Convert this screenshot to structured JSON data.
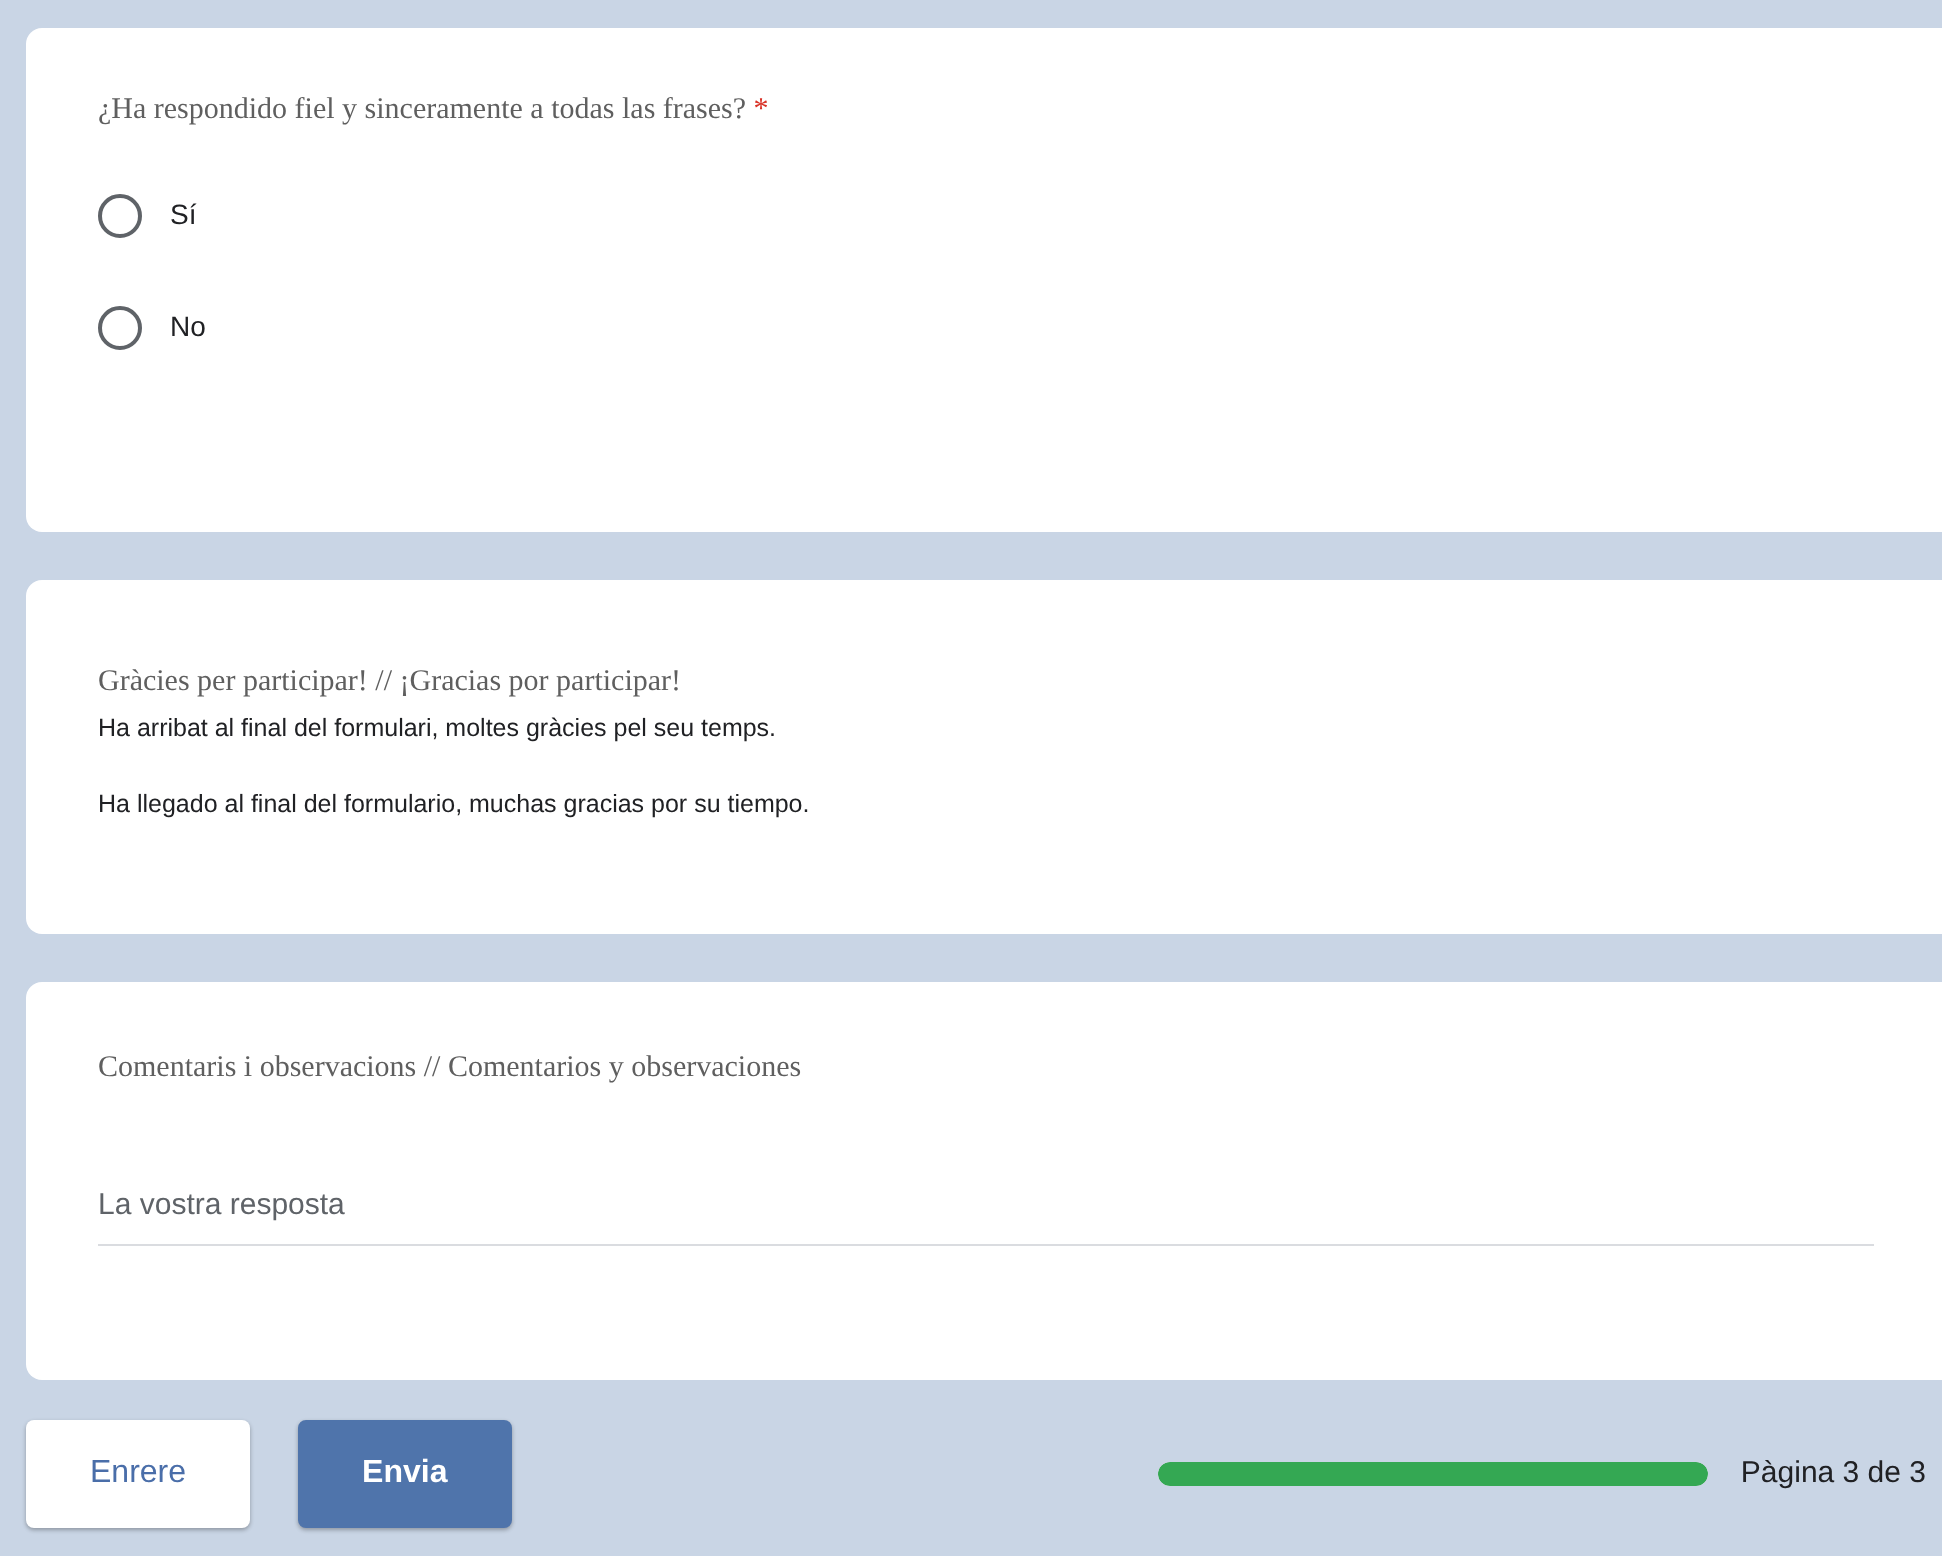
{
  "question": {
    "title": "¿Ha respondido fiel y sinceramente a todas las frases?",
    "required_mark": "*",
    "options": [
      {
        "label": "Sí",
        "selected": false
      },
      {
        "label": "No",
        "selected": false
      }
    ]
  },
  "thanks": {
    "title": "Gràcies per participar! // ¡Gracias por participar!",
    "paragraphs": [
      "Ha arribat al final del formulari, moltes gràcies pel seu temps.",
      "Ha llegado al final del formulario, muchas gracias por su tiempo."
    ]
  },
  "comments": {
    "title": "Comentaris i observacions // Comentarios y observaciones",
    "placeholder": "La vostra resposta"
  },
  "footer": {
    "back": "Enrere",
    "submit": "Envia",
    "progress": {
      "level": 1.0
    },
    "page_label": "Pàgina 3 de 3"
  }
}
